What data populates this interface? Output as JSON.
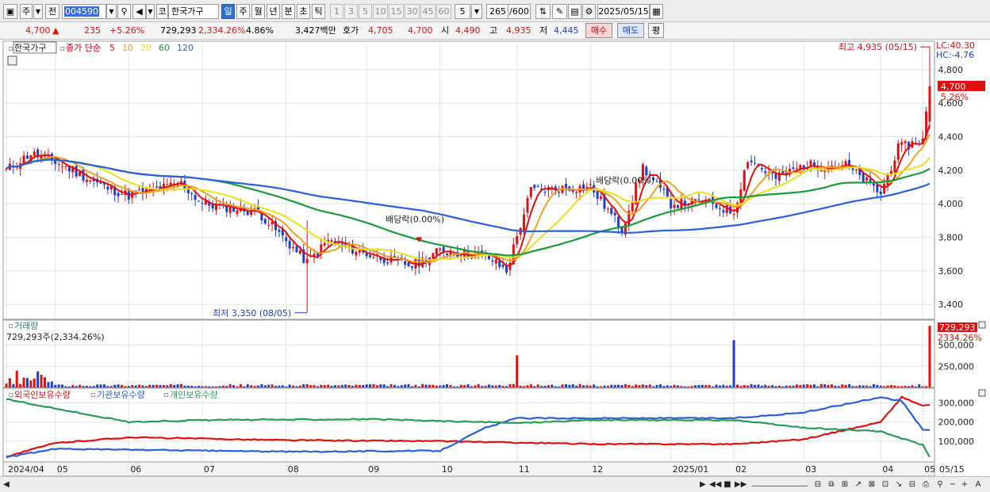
{
  "toolbar": {
    "type_label": "주",
    "prev_label": "전",
    "stock_code": "004590",
    "stock_name_prefix": "코",
    "stock_name": "한국가구",
    "periods": [
      "일",
      "주",
      "월",
      "년",
      "분",
      "초",
      "틱"
    ],
    "minute_options": [
      "1",
      "3",
      "5",
      "10",
      "15",
      "30",
      "45",
      "60"
    ],
    "custom_interval": "5",
    "count_value": "265",
    "count_max": "/600",
    "date": "2025/05/15"
  },
  "quote": {
    "price": "4,700",
    "change_arrow": "▲",
    "change": "235",
    "change_pct": "+5.26%",
    "volume": "729,293",
    "volume_ratio": "2,334.26%",
    "turnover_pct": "4.86%",
    "amount": "3,427백만",
    "ask_label": "호가",
    "ask_price": "4,705",
    "bid_price": "4,700",
    "open_label": "시",
    "open": "4,490",
    "high_label": "고",
    "high": "4,935",
    "low_label": "저",
    "low": "4,445",
    "buy_label": "매수",
    "sell_label": "매도",
    "eval_label": "평"
  },
  "price_panel": {
    "stock_label": "한국가구",
    "ma_title": "종가 단순",
    "ma_periods": [
      {
        "label": "5",
        "color": "#e01010"
      },
      {
        "label": "10",
        "color": "#f0a020"
      },
      {
        "label": "20",
        "color": "#e8e020"
      },
      {
        "label": "60",
        "color": "#1a9a3a"
      },
      {
        "label": "120",
        "color": "#2a5fd8"
      }
    ],
    "lc_label": "LC:40.30",
    "hc_label": "HC:-4.76",
    "current_price_label": "4,700",
    "current_pct_label": "5.26%",
    "high_annotation": "최고 4,935 (05/15)",
    "low_annotation": "최저 3,350 (08/05)",
    "dividend_label_1": "배당락(0.00%)",
    "dividend_label_2": "배당락(0.00%)",
    "y_ticks": [
      "4,800",
      "4,600",
      "4,400",
      "4,200",
      "4,000",
      "3,800",
      "3,600",
      "3,400"
    ]
  },
  "volume_panel": {
    "title": "거래량",
    "summary": "729,293주(2,334.26%)",
    "current_label": "729,293",
    "current_pct": "2334.26%",
    "y_ticks": [
      "500,000",
      "250,000"
    ]
  },
  "holdings_panel": {
    "series_labels": [
      {
        "label": "외국인보유수량",
        "color": "#e01010"
      },
      {
        "label": "기관보유수량",
        "color": "#2a5fd8"
      },
      {
        "label": "개인보유수량",
        "color": "#2a9a5a"
      }
    ],
    "y_ticks": [
      "300,000",
      "200,000",
      "100,000"
    ]
  },
  "x_axis": {
    "labels": [
      "2024/04",
      "05",
      "06",
      "07",
      "08",
      "09",
      "10",
      "11",
      "12",
      "2025/01",
      "02",
      "03",
      "04",
      "05"
    ],
    "end_label": "05/15"
  },
  "colors": {
    "up": "#e01010",
    "down": "#1a3fd0",
    "accent": "#2f6fd0",
    "grid": "#e4e4e4"
  },
  "chart_data": {
    "type": "candlestick",
    "title": "한국가구",
    "period": "daily",
    "date_range": [
      "2024/04",
      "2025/05/15"
    ],
    "ylim": [
      3330,
      4950
    ],
    "anchors": [
      {
        "date": "2024/04",
        "close": 4200
      },
      {
        "date": "2024/04 mid",
        "close": 4300
      },
      {
        "date": "2024/05",
        "close": 4250
      },
      {
        "date": "2024/05 late",
        "close": 4100
      },
      {
        "date": "2024/06",
        "close": 4050
      },
      {
        "date": "2024/06 late",
        "close": 4120
      },
      {
        "date": "2024/07",
        "close": 4000
      },
      {
        "date": "2024/07 late",
        "close": 3950
      },
      {
        "date": "2024/08/05",
        "close": 3650,
        "low": 3350
      },
      {
        "date": "2024/08 late",
        "close": 3780
      },
      {
        "date": "2024/09",
        "close": 3700
      },
      {
        "date": "2024/09 late",
        "close": 3630
      },
      {
        "date": "2024/10",
        "close": 3720
      },
      {
        "date": "2024/10 late",
        "close": 3690
      },
      {
        "date": "2024/11 mid",
        "close": 3600
      },
      {
        "date": "2024/11 late",
        "close": 4080
      },
      {
        "date": "2024/12",
        "close": 4100
      },
      {
        "date": "2024/12 mid",
        "close": 3850
      },
      {
        "date": "2024/12 late",
        "close": 4220
      },
      {
        "date": "2025/01",
        "close": 4000
      },
      {
        "date": "2025/01 late",
        "close": 4010
      },
      {
        "date": "2025/02",
        "close": 3950
      },
      {
        "date": "2025/02 mid",
        "close": 4270
      },
      {
        "date": "2025/02 late",
        "close": 4150
      },
      {
        "date": "2025/03",
        "close": 4230
      },
      {
        "date": "2025/03 late",
        "close": 4230
      },
      {
        "date": "2025/04",
        "close": 4060
      },
      {
        "date": "2025/04 mid",
        "close": 4330
      },
      {
        "date": "2025/05",
        "close": 4380
      },
      {
        "date": "2025/05/15",
        "open": 4490,
        "high": 4935,
        "low": 4445,
        "close": 4700
      }
    ],
    "moving_averages": [
      "5",
      "10",
      "20",
      "60",
      "120"
    ],
    "volume": {
      "last": 729293,
      "spikes": [
        {
          "date": "2024/04",
          "value": 200000
        },
        {
          "date": "2024/11",
          "value": 380000
        },
        {
          "date": "2025/02",
          "value": 560000
        },
        {
          "date": "2025/05/15",
          "value": 729293
        }
      ],
      "ylim": [
        0,
        760000
      ]
    },
    "holdings": {
      "ylim": [
        0,
        360000
      ],
      "series": [
        {
          "name": "외국인보유수량",
          "points": [
            {
              "date": "2024/04",
              "value": 20000
            },
            {
              "date": "2024/05",
              "value": 90000
            },
            {
              "date": "2024/06",
              "value": 120000
            },
            {
              "date": "2024/08",
              "value": 105000
            },
            {
              "date": "2024/10",
              "value": 100000
            },
            {
              "date": "2024/12",
              "value": 85000
            },
            {
              "date": "2025/02",
              "value": 85000
            },
            {
              "date": "2025/03",
              "value": 110000
            },
            {
              "date": "2025/04",
              "value": 200000
            },
            {
              "date": "2025/04 late",
              "value": 330000
            },
            {
              "date": "2025/05",
              "value": 285000
            },
            {
              "date": "2025/05/15",
              "value": 290000
            }
          ]
        },
        {
          "name": "기관보유수량",
          "points": [
            {
              "date": "2024/04",
              "value": 15000
            },
            {
              "date": "2024/05",
              "value": 60000
            },
            {
              "date": "2024/08",
              "value": 45000
            },
            {
              "date": "2024/10",
              "value": 50000
            },
            {
              "date": "2024/10 late",
              "value": 170000
            },
            {
              "date": "2024/11",
              "value": 220000
            },
            {
              "date": "2025/02",
              "value": 220000
            },
            {
              "date": "2025/03",
              "value": 250000
            },
            {
              "date": "2025/04",
              "value": 330000
            },
            {
              "date": "2025/04 late",
              "value": 310000
            },
            {
              "date": "2025/05",
              "value": 160000
            },
            {
              "date": "2025/05/15",
              "value": 160000
            }
          ]
        },
        {
          "name": "개인보유수량",
          "points": [
            {
              "date": "2024/04",
              "value": 320000
            },
            {
              "date": "2024/05",
              "value": 270000
            },
            {
              "date": "2024/06",
              "value": 200000
            },
            {
              "date": "2024/07",
              "value": 210000
            },
            {
              "date": "2024/09",
              "value": 215000
            },
            {
              "date": "2024/11",
              "value": 195000
            },
            {
              "date": "2024/12",
              "value": 210000
            },
            {
              "date": "2025/02",
              "value": 210000
            },
            {
              "date": "2025/03",
              "value": 170000
            },
            {
              "date": "2025/04",
              "value": 150000
            },
            {
              "date": "2025/05",
              "value": 80000
            },
            {
              "date": "2025/05/15",
              "value": 20000
            }
          ]
        }
      ]
    }
  }
}
